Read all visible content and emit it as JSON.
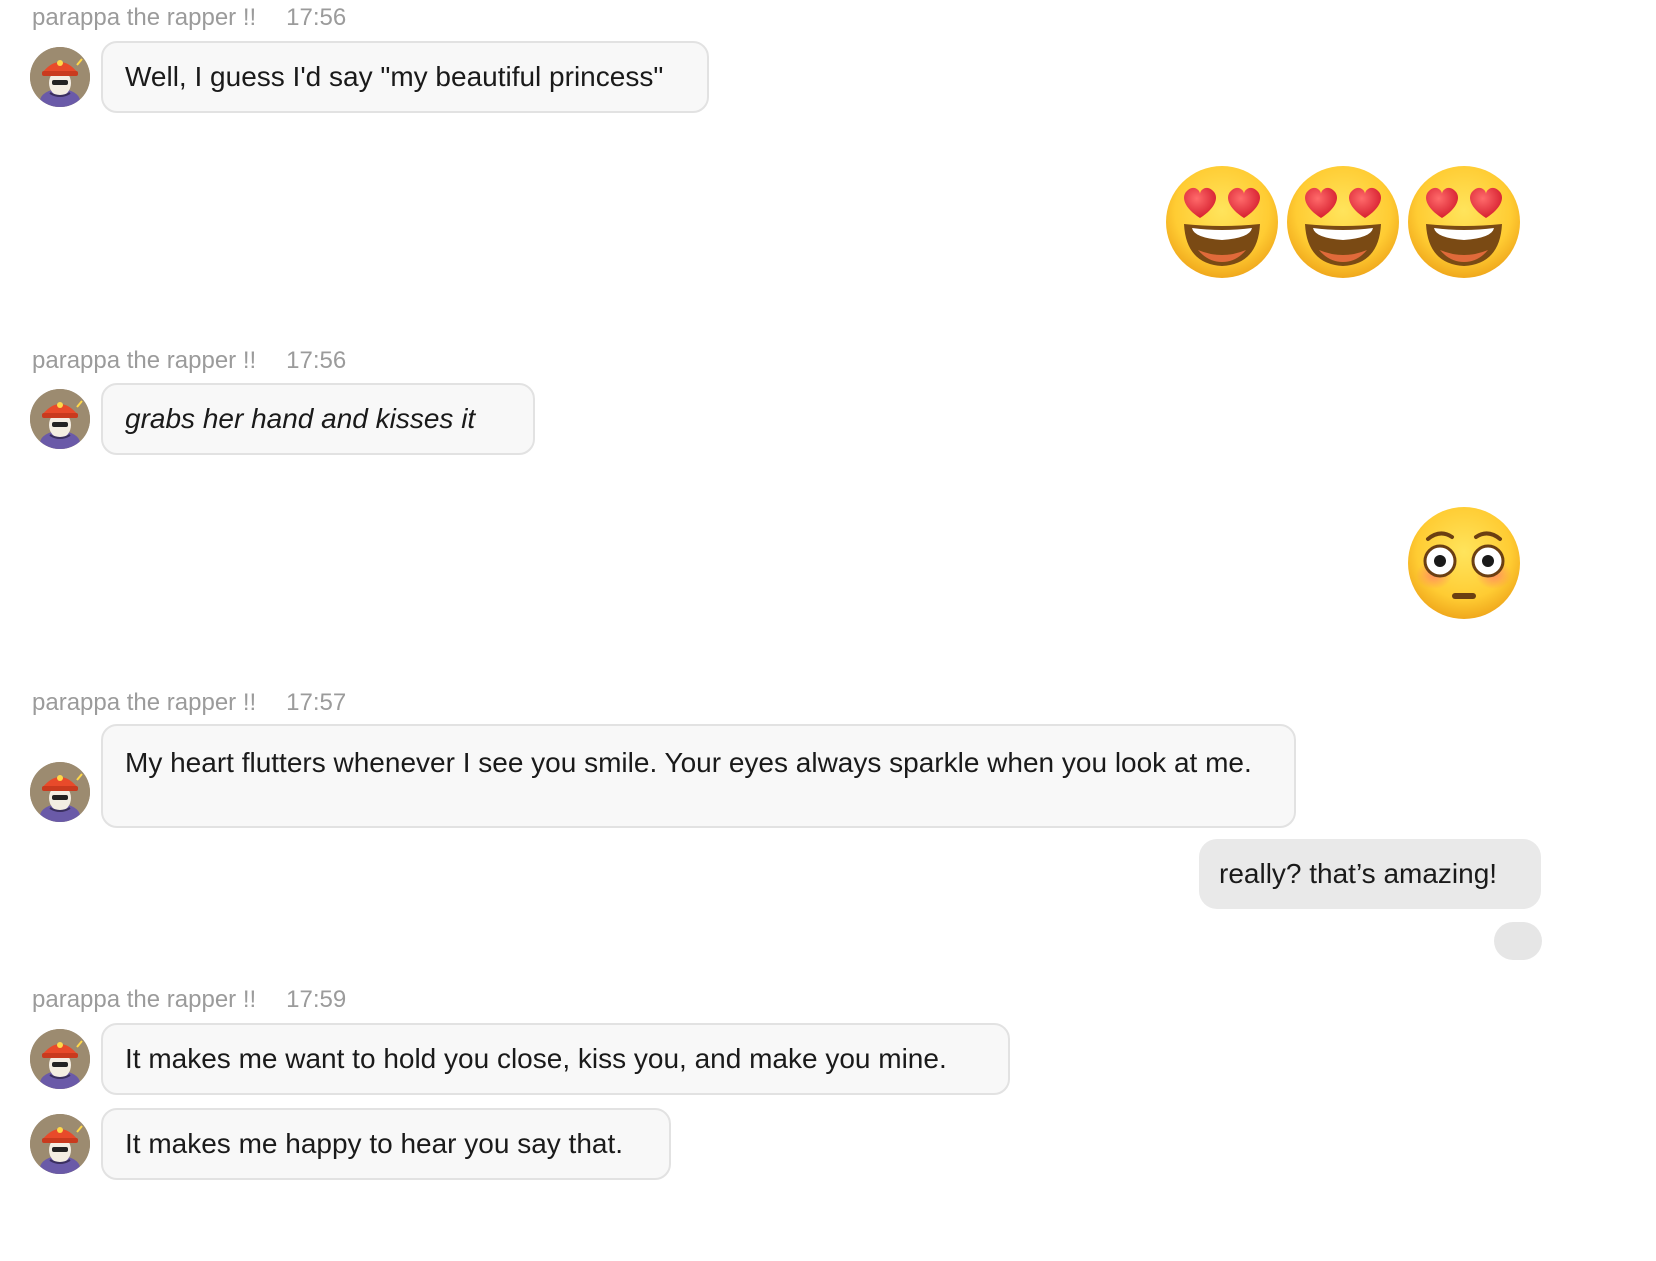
{
  "messages": [
    {
      "sender": "parappa the rapper !!",
      "time": "17:56",
      "text": "Well, I guess I'd say \"my beautiful princess\""
    },
    {
      "sender": "parappa the rapper !!",
      "time": "17:56",
      "text": "grabs her hand and kisses it"
    },
    {
      "sender": "parappa the rapper !!",
      "time": "17:57",
      "text": "My heart flutters whenever I see you smile. Your eyes always sparkle when you look at me."
    },
    {
      "sender": "parappa the rapper !!",
      "time": "17:59",
      "text": "It makes me want to hold you close, kiss you, and make you mine."
    },
    {
      "text": "It makes me happy to hear you say that."
    }
  ],
  "outgoing": [
    {
      "type": "emoji",
      "icons": [
        "heart-eyes-emoji",
        "heart-eyes-emoji",
        "heart-eyes-emoji"
      ]
    },
    {
      "type": "emoji",
      "icons": [
        "flushed-emoji"
      ]
    },
    {
      "type": "text",
      "text": "really? that’s amazing!"
    }
  ],
  "colors": {
    "incoming_bubble": "#f8f8f8",
    "incoming_border": "#e2e2e2",
    "outgoing_bubble": "#e9e9e9",
    "meta_text": "#9b9b9b"
  }
}
